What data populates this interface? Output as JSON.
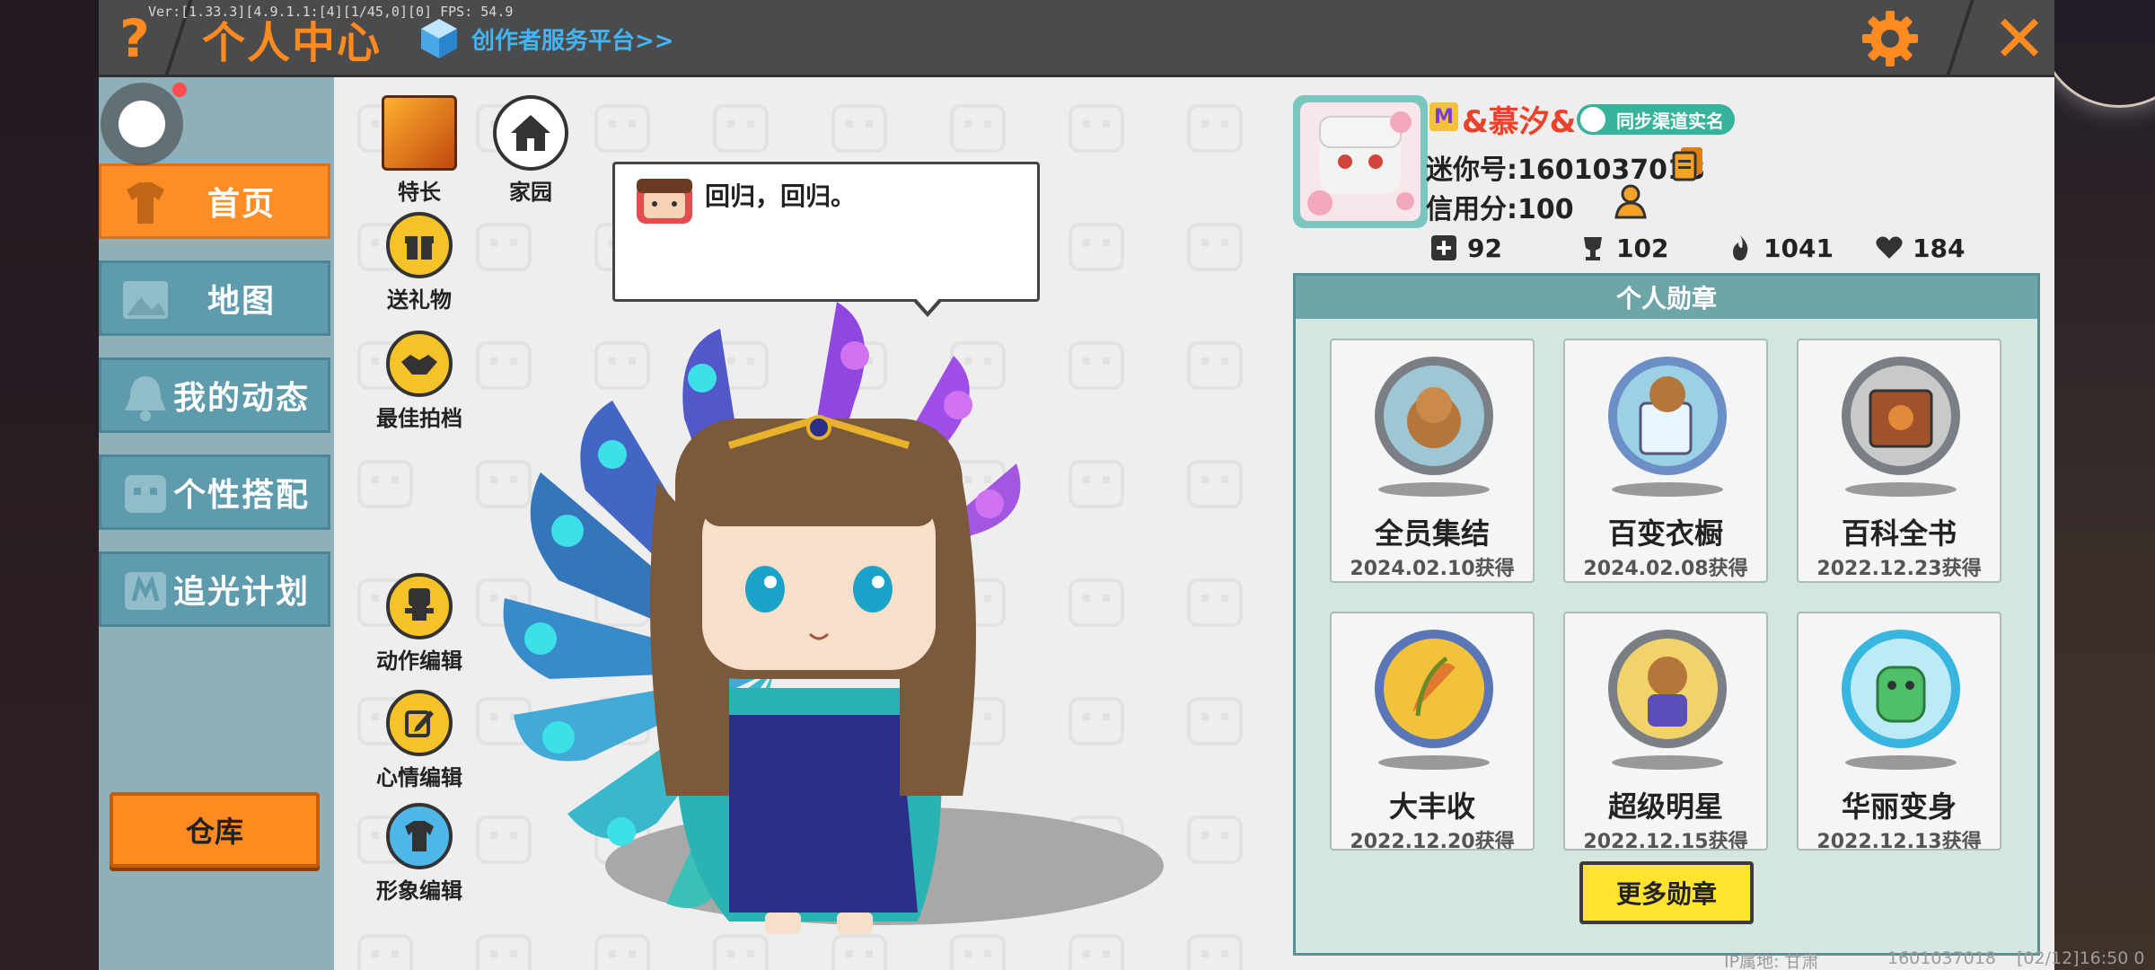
{
  "topbar": {
    "version_text": "Ver:[1.33.3][4.9.1.1:[4][1/45,0][0] FPS: 54.9",
    "help_label": "?",
    "title": "个人中心",
    "creator_link": "创作者服务平台>>",
    "close_label": "✕"
  },
  "nav": {
    "items": [
      {
        "label": "首页",
        "active": true
      },
      {
        "label": "地图",
        "active": false
      },
      {
        "label": "我的动态",
        "active": false
      },
      {
        "label": "个性搭配",
        "active": false
      },
      {
        "label": "追光计划",
        "active": false
      }
    ],
    "warehouse_label": "仓库"
  },
  "center": {
    "buttons": {
      "talent": "特长",
      "home": "家园",
      "gift": "送礼物",
      "best_photo": "最佳拍档",
      "action_edit": "动作编辑",
      "mood_edit": "心情编辑",
      "image_edit": "形象编辑"
    },
    "speech_text": "回归，回归。"
  },
  "profile": {
    "vip_label": "M",
    "nickname": "&慕汐&",
    "sync_badge": "同步渠道实名",
    "mini_id": "迷你号:1601037018",
    "credit": "信用分:100",
    "stats": {
      "add": "92",
      "cup": "102",
      "fire": "1041",
      "heart": "184"
    }
  },
  "medals": {
    "header": "个人勋章",
    "items": [
      {
        "name": "全员集结",
        "date": "2024.02.10获得",
        "icon": "monkey-medal-icon"
      },
      {
        "name": "百变衣橱",
        "date": "2024.02.08获得",
        "icon": "wardrobe-medal-icon"
      },
      {
        "name": "百科全书",
        "date": "2022.12.23获得",
        "icon": "book-medal-icon"
      },
      {
        "name": "大丰收",
        "date": "2022.12.20获得",
        "icon": "harvest-medal-icon"
      },
      {
        "name": "超级明星",
        "date": "2022.12.15获得",
        "icon": "star-medal-icon"
      },
      {
        "name": "华丽变身",
        "date": "2022.12.13获得",
        "icon": "transform-medal-icon"
      }
    ],
    "more_label": "更多勋章"
  },
  "footer": {
    "ip": "IP属地: 甘肃",
    "uid": "1601037018",
    "time": "[02/12]16:50 0"
  },
  "colors": {
    "accent_orange": "#ff8a1f",
    "nav_blue": "#5e9bad",
    "medal_bg": "#d3e7e0",
    "more_button": "#ffe32e"
  }
}
